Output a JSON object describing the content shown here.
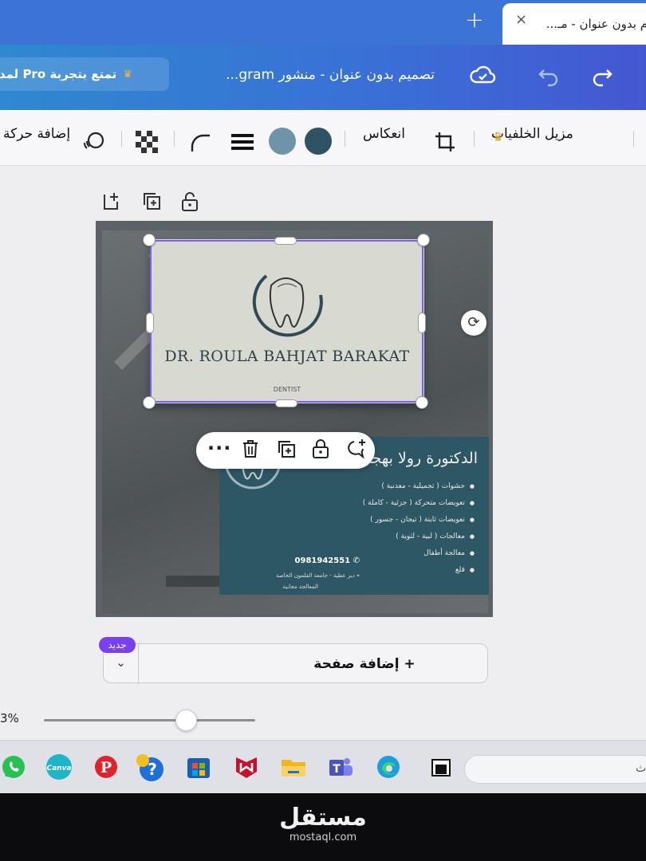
{
  "browser": {
    "tab_title": "م بدون عنوان - مـ...",
    "close_glyph": "×",
    "new_tab_glyph": "+"
  },
  "header": {
    "pro_banner": "تمتع بتجربة Pro لمدة",
    "crown_glyph": "♛",
    "doc_title": "تصميم بدون عنوان - منشور gram...",
    "icons": [
      "cloud-check-icon",
      "undo-icon",
      "redo-icon"
    ]
  },
  "toolbar": {
    "bg_remover": "مزيل الخلفيات",
    "crop_glyph": "⌗",
    "flip": "انعكاس",
    "add_animation": "إضافة حركة",
    "swatch_colors": [
      "#2f5264",
      "#6f93a9"
    ],
    "icons": [
      "crown-icon",
      "crop-icon",
      "stroke-lines-icon",
      "corner-radius-icon",
      "transparency-icon",
      "animate-icon"
    ]
  },
  "page_tools": {
    "icons": [
      "add-page-icon",
      "duplicate-page-icon",
      "lock-icon"
    ]
  },
  "design": {
    "front": {
      "name": "DR. ROULA BAHJAT BARAKAT",
      "subtitle": "DENTIST"
    },
    "back": {
      "title": "الدكتورة رولا بهجت",
      "services": [
        "حشوات ( تجميلية - معدنية )",
        "تعويضات متحركة ( جزئية - كاملة )",
        "تعويضات ثابتة ( تيجان - جسور )",
        "معالجات ( لبية - لثوية )",
        "معالجة أطفال",
        "قلع"
      ],
      "phone": "0981942551",
      "address": "دير عطية - جامعة القلمون الخاصة",
      "free_note": "المعالجة مجانية"
    },
    "accent_color": "#7b5ff6"
  },
  "float_toolbar": {
    "icons": [
      "more-icon",
      "trash-icon",
      "duplicate-icon",
      "lock-icon",
      "add-comment-icon"
    ]
  },
  "add_page": {
    "label": "+ إضافة صفحة",
    "badge": "جديد"
  },
  "zoom": {
    "text": "3%"
  },
  "taskbar": {
    "icons": [
      "whatsapp-icon",
      "canva-icon",
      "pinterest-icon",
      "help-icon",
      "microsoft-store-icon",
      "mcafee-icon",
      "file-explorer-icon",
      "teams-icon",
      "edge-icon",
      "terminal-icon"
    ],
    "canva_label": "Canva",
    "search_hint": "ث"
  },
  "watermark": {
    "brand": "مستقل",
    "domain": "mostaql.com"
  }
}
